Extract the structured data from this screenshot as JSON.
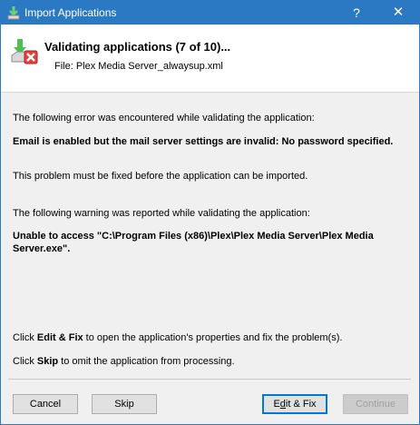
{
  "window": {
    "title": "Import Applications",
    "help_glyph": "?",
    "close_glyph": "✕",
    "accent_color": "#2b79c2"
  },
  "header": {
    "title": "Validating applications (7 of 10)...",
    "file_line": "File: Plex Media Server_alwaysup.xml",
    "icon": "import-error-icon"
  },
  "body": {
    "error_intro": "The following error was encountered while validating the application:",
    "error_message": "Email is enabled but the mail server settings are invalid: No password specified.",
    "error_note": "This problem must be fixed before the application can be imported.",
    "warning_intro": "The following warning was reported while validating the application:",
    "warning_message": "Unable to access \"C:\\Program Files (x86)\\Plex\\Plex Media Server\\Plex Media Server.exe\".",
    "hint_fix_pre": "Click ",
    "hint_fix_bold": "Edit & Fix",
    "hint_fix_post": " to open the application's properties and fix the problem(s).",
    "hint_skip_pre": "Click ",
    "hint_skip_bold": "Skip",
    "hint_skip_post": " to omit the application from processing."
  },
  "buttons": {
    "cancel": "Cancel",
    "skip": "Skip",
    "edit_fix_pre": "E",
    "edit_fix_ul": "d",
    "edit_fix_post": "it & Fix",
    "continue": "Continue"
  }
}
